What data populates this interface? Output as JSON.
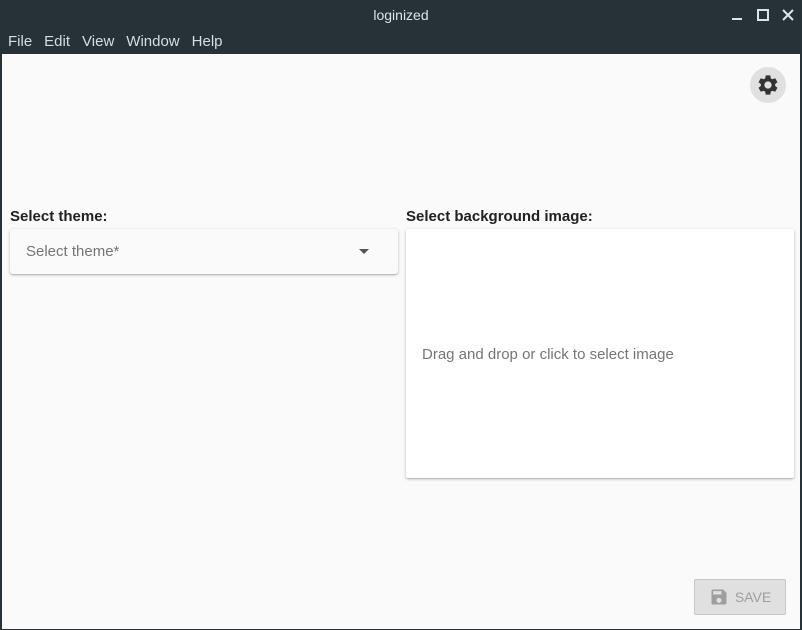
{
  "window": {
    "title": "loginized"
  },
  "menu": {
    "items": [
      "File",
      "Edit",
      "View",
      "Window",
      "Help"
    ]
  },
  "settings": {
    "icon": "gear-icon"
  },
  "theme": {
    "label": "Select theme:",
    "placeholder": "Select theme*"
  },
  "background": {
    "label": "Select background image:",
    "hint": "Drag and drop or click to select image"
  },
  "actions": {
    "save_label": "SAVE",
    "save_icon": "floppy-disk-icon"
  }
}
